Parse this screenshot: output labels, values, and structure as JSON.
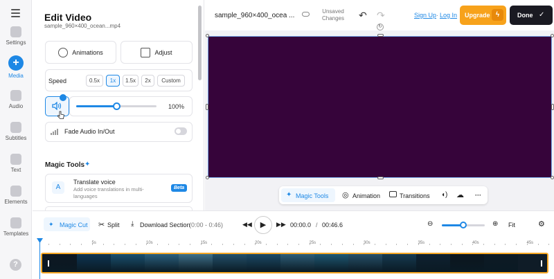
{
  "sidebar": {
    "items": [
      {
        "label": "Settings"
      },
      {
        "label": "Media"
      },
      {
        "label": "Audio"
      },
      {
        "label": "Subtitles"
      },
      {
        "label": "Text"
      },
      {
        "label": "Elements"
      },
      {
        "label": "Templates"
      }
    ],
    "help": "?"
  },
  "panel": {
    "title": "Edit Video",
    "filename": "sample_960×400_ocean...mp4",
    "animations": "Animations",
    "adjust": "Adjust",
    "speed_label": "Speed",
    "speed_options": [
      "0.5x",
      "1x",
      "1.5x",
      "2x",
      "Custom"
    ],
    "speed_selected": "1x",
    "volume": "100%",
    "volume_level": 0.5,
    "fade_label": "Fade Audio In/Out",
    "magic_tools_title": "Magic Tools",
    "translate_title": "Translate voice",
    "translate_desc": "Add voice translations in multi-languages",
    "beta": "Beta"
  },
  "header": {
    "filename": "sample_960×400_ocea ...",
    "unsaved": "Unsaved Changes",
    "sign_up": "Sign Up",
    "separator": "·",
    "log_in": "Log In",
    "upgrade": "Upgrade",
    "done": "Done"
  },
  "stage": {
    "canvas_color": "#36043a",
    "toolbar": {
      "magic_tools": "Magic Tools",
      "animation": "Animation",
      "transitions": "Transitions",
      "more": "···"
    }
  },
  "timeline": {
    "magic_cut": "Magic Cut",
    "split": "Split",
    "download_section": "Download Section",
    "download_range": "(0:00 - 0:46)",
    "current_time": "00:00.0",
    "time_separator": "/",
    "total_time": "00:46.6",
    "fit": "Fit",
    "zoom_level": 0.5,
    "ruler_ticks": [
      "5s",
      "10s",
      "15s",
      "20s",
      "25s",
      "30s",
      "35s",
      "40s",
      "45s"
    ]
  },
  "colors": {
    "accent": "#1e88e5",
    "upgrade": "#f7a21b",
    "track_border": "#f5a623"
  }
}
